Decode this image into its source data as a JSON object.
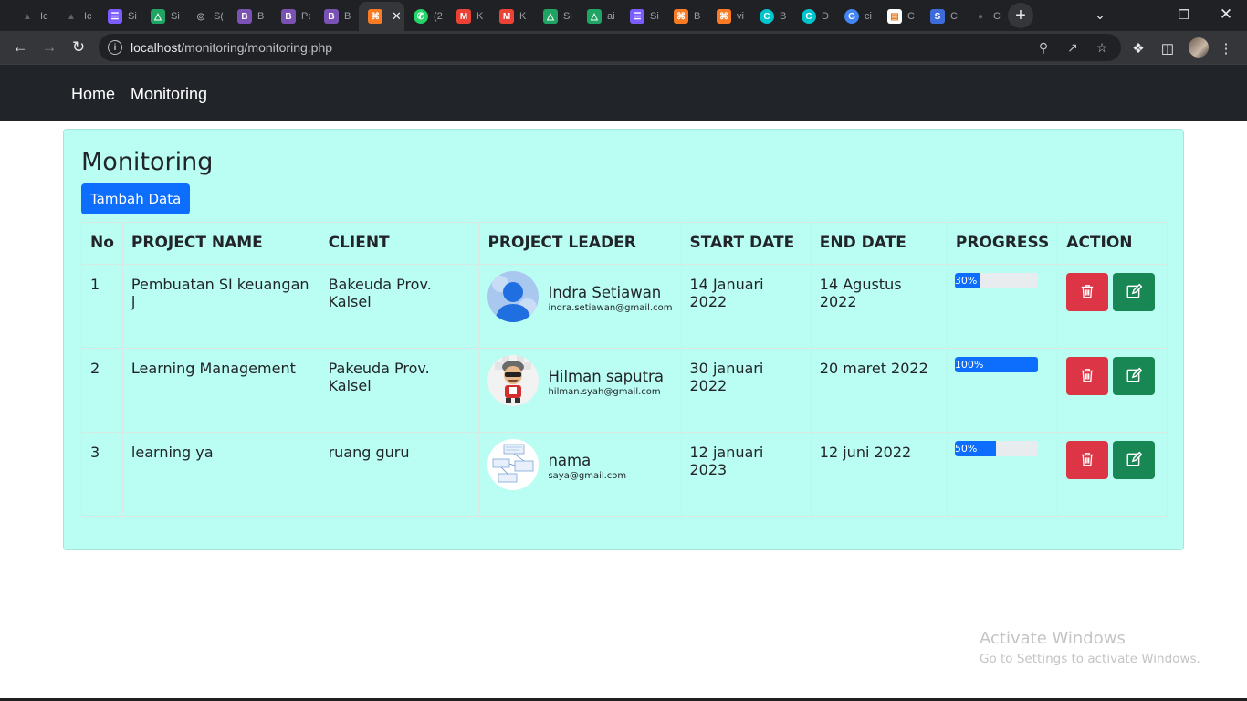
{
  "browser": {
    "tabs": [
      {
        "label": "Ic",
        "icon": "triangle-logo-icon",
        "color": "#5f6368"
      },
      {
        "label": "Ic",
        "icon": "triangle-logo-icon",
        "color": "#5f6368"
      },
      {
        "label": "Si",
        "icon": "list-icon",
        "color": "#7b5cff"
      },
      {
        "label": "Si",
        "icon": "drive-icon",
        "color": "#1fa463"
      },
      {
        "label": "S(",
        "icon": "globe-icon",
        "color": "#9aa0a6"
      },
      {
        "label": "B",
        "icon": "bootstrap-icon",
        "color": "#7952b3"
      },
      {
        "label": "Pe",
        "icon": "bootstrap-icon",
        "color": "#7952b3"
      },
      {
        "label": "B",
        "icon": "bootstrap-icon",
        "color": "#7952b3"
      },
      {
        "label": "",
        "icon": "xampp-icon",
        "color": "#fb7a24"
      },
      {
        "label": "(2",
        "icon": "whatsapp-icon",
        "color": "#25d366"
      },
      {
        "label": "K",
        "icon": "gmail-icon",
        "color": "#ea4335"
      },
      {
        "label": "K",
        "icon": "gmail-icon",
        "color": "#ea4335"
      },
      {
        "label": "Si",
        "icon": "drive-icon",
        "color": "#1fa463"
      },
      {
        "label": "ai",
        "icon": "drive-icon",
        "color": "#1fa463"
      },
      {
        "label": "Si",
        "icon": "list-icon",
        "color": "#7b5cff"
      },
      {
        "label": "B",
        "icon": "xampp-icon",
        "color": "#fb7a24"
      },
      {
        "label": "vi",
        "icon": "xampp-icon",
        "color": "#fb7a24"
      },
      {
        "label": "B",
        "icon": "canva-icon",
        "color": "#00c4cc"
      },
      {
        "label": "D",
        "icon": "canva-icon",
        "color": "#00c4cc"
      },
      {
        "label": "ci",
        "icon": "google-icon",
        "color": "#4285f4"
      },
      {
        "label": "C",
        "icon": "page-icon",
        "color": "#ffffff"
      },
      {
        "label": "C",
        "icon": "s-logo-icon",
        "color": "#3d6bd9"
      },
      {
        "label": "C",
        "icon": "github-icon",
        "color": "#5f6368"
      }
    ],
    "active_tab_index": 8,
    "url_host": "localhost",
    "url_path": "/monitoring/monitoring.php"
  },
  "navbar": {
    "home": "Home",
    "monitoring": "Monitoring"
  },
  "main": {
    "title": "Monitoring",
    "add_button": "Tambah Data",
    "columns": [
      "No",
      "PROJECT NAME",
      "CLIENT",
      "PROJECT LEADER",
      "START DATE",
      "END DATE",
      "PROGRESS",
      "ACTION"
    ],
    "rows": [
      {
        "no": "1",
        "project": "Pembuatan SI keuangan j",
        "client": "Bakeuda Prov. Kalsel",
        "leader_name": "Indra Setiawan",
        "leader_email": "indra.setiawan@gmail.com",
        "avatar": "default-user-avatar",
        "start": "14 Januari 2022",
        "end": "14 Agustus 2022",
        "progress": 30,
        "progress_label": "30%"
      },
      {
        "no": "2",
        "project": "Learning Management",
        "client": "Pakeuda Prov. Kalsel",
        "leader_name": "Hilman saputra",
        "leader_email": "hilman.syah@gmail.com",
        "avatar": "cartoon-character-avatar",
        "start": "30 januari 2022",
        "end": "20 maret 2022",
        "progress": 100,
        "progress_label": "100%"
      },
      {
        "no": "3",
        "project": "learning ya",
        "client": "ruang guru",
        "leader_name": "nama",
        "leader_email": "saya@gmail.com",
        "avatar": "diagram-screenshot-avatar",
        "start": "12 januari 2023",
        "end": "12 juni 2022",
        "progress": 50,
        "progress_label": "50%"
      }
    ]
  },
  "watermark": {
    "line1": "Activate Windows",
    "line2": "Go to Settings to activate Windows."
  },
  "colors": {
    "card_bg": "#bafdf2",
    "primary": "#0d6efd",
    "danger": "#dc3545",
    "success": "#198754",
    "navbar_bg": "#212529"
  }
}
